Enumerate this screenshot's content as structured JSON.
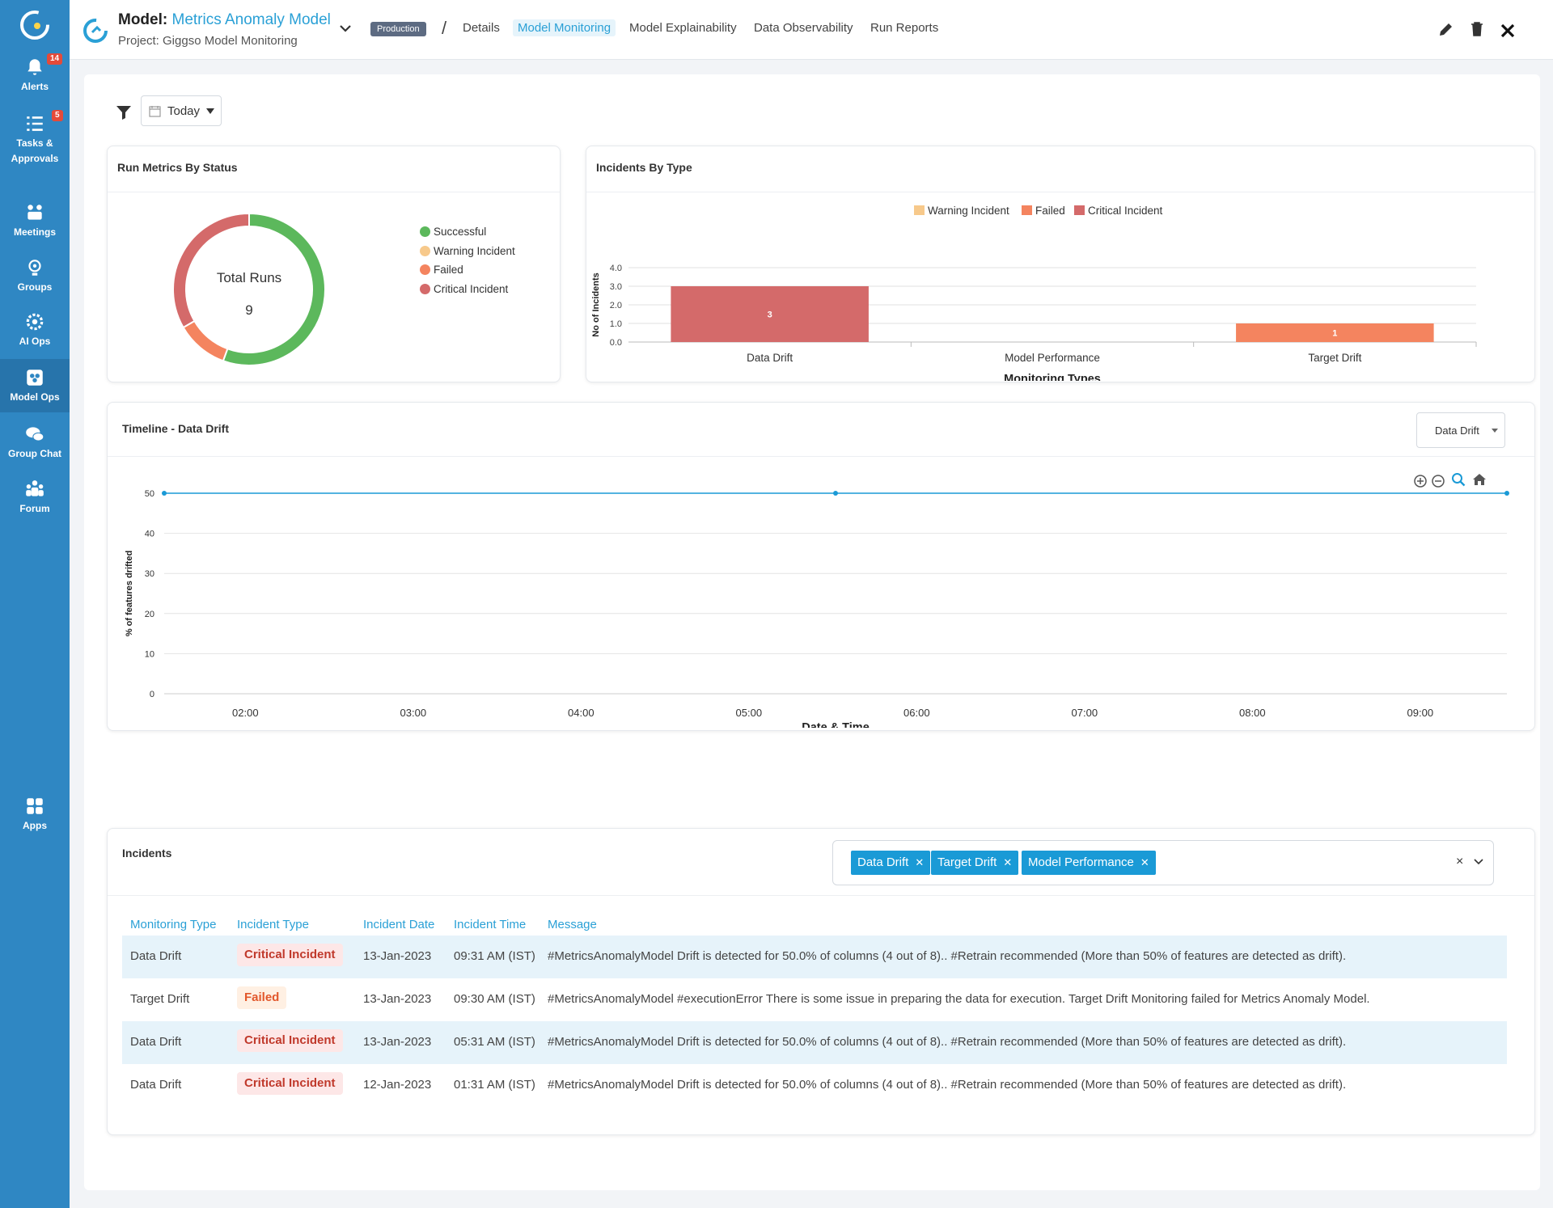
{
  "sidebar": {
    "items": [
      {
        "label": "Alerts",
        "badge": "14",
        "icon": "bell-icon"
      },
      {
        "label": "Tasks & Approvals",
        "badge": "5",
        "icon": "tasks-icon"
      },
      {
        "label": "Meetings",
        "icon": "meetings-icon"
      },
      {
        "label": "Groups",
        "icon": "groups-icon"
      },
      {
        "label": "AI Ops",
        "icon": "ai-ops-icon"
      },
      {
        "label": "Model Ops",
        "icon": "model-ops-icon",
        "active": true
      },
      {
        "label": "Group Chat",
        "icon": "chat-icon"
      },
      {
        "label": "Forum",
        "icon": "forum-icon"
      },
      {
        "label": "Apps",
        "icon": "apps-icon"
      }
    ]
  },
  "header": {
    "model_prefix": "Model:",
    "model_name": "Metrics Anomaly Model",
    "project": "Project: Giggso Model Monitoring",
    "env_badge": "Production",
    "separator": "/",
    "tabs": [
      "Details",
      "Model Monitoring",
      "Model Explainability",
      "Data Observability",
      "Run Reports"
    ],
    "active_tab": "Model Monitoring"
  },
  "filter": {
    "date_range": "Today"
  },
  "run_metrics": {
    "title": "Run Metrics By Status",
    "center_label": "Total Runs",
    "center_value": "9",
    "legend": [
      {
        "label": "Successful",
        "color": "#5cb85c"
      },
      {
        "label": "Warning Incident",
        "color": "#f7c98b"
      },
      {
        "label": "Failed",
        "color": "#f4845f"
      },
      {
        "label": "Critical Incident",
        "color": "#d46a6a"
      }
    ]
  },
  "incidents_by_type": {
    "title": "Incidents By Type",
    "legend": [
      {
        "label": "Warning Incident",
        "color": "#f7c98b"
      },
      {
        "label": "Failed",
        "color": "#f4845f"
      },
      {
        "label": "Critical Incident",
        "color": "#d46a6a"
      }
    ]
  },
  "timeline": {
    "title": "Timeline - Data Drift",
    "selector": "Data Drift"
  },
  "incidents": {
    "title": "Incidents",
    "tags": [
      "Data Drift",
      "Target Drift",
      "Model Performance"
    ],
    "clear": "×",
    "columns": [
      "Monitoring Type",
      "Incident Type",
      "Incident Date",
      "Incident Time",
      "Message"
    ],
    "rows": [
      {
        "monitoring_type": "Data Drift",
        "incident_type": "Critical Incident",
        "date": "13-Jan-2023",
        "time": "09:31 AM (IST)",
        "message": "#MetricsAnomalyModel Drift is detected for 50.0% of columns (4 out of 8).. #Retrain recommended (More than 50% of features are detected as drift)."
      },
      {
        "monitoring_type": "Target Drift",
        "incident_type": "Failed",
        "date": "13-Jan-2023",
        "time": "09:30 AM (IST)",
        "message": "#MetricsAnomalyModel #executionError There is some issue in preparing the data for execution. Target Drift Monitoring failed for Metrics Anomaly Model."
      },
      {
        "monitoring_type": "Data Drift",
        "incident_type": "Critical Incident",
        "date": "13-Jan-2023",
        "time": "05:31 AM (IST)",
        "message": "#MetricsAnomalyModel Drift is detected for 50.0% of columns (4 out of 8).. #Retrain recommended (More than 50% of features are detected as drift)."
      },
      {
        "monitoring_type": "Data Drift",
        "incident_type": "Critical Incident",
        "date": "12-Jan-2023",
        "time": "01:31 AM (IST)",
        "message": "#MetricsAnomalyModel Drift is detected for 50.0% of columns (4 out of 8).. #Retrain recommended (More than 50% of features are detected as drift)."
      }
    ]
  },
  "chart_data": [
    {
      "type": "pie",
      "title": "Run Metrics By Status",
      "categories": [
        "Successful",
        "Warning Incident",
        "Failed",
        "Critical Incident"
      ],
      "values": [
        5,
        0,
        1,
        3
      ],
      "colors": [
        "#5cb85c",
        "#f7c98b",
        "#f4845f",
        "#d46a6a"
      ],
      "total": 9
    },
    {
      "type": "bar",
      "title": "Incidents By Type",
      "categories": [
        "Data Drift",
        "Model Performance",
        "Target Drift"
      ],
      "series": [
        {
          "name": "Warning Incident",
          "values": [
            0,
            0,
            0
          ],
          "color": "#f7c98b"
        },
        {
          "name": "Failed",
          "values": [
            0,
            0,
            1
          ],
          "color": "#f4845f"
        },
        {
          "name": "Critical Incident",
          "values": [
            3,
            0,
            0
          ],
          "color": "#d46a6a"
        }
      ],
      "xlabel": "Monitoring Types",
      "ylabel": "No of Incidents",
      "ylim": [
        0,
        4
      ],
      "yticks": [
        "0.0",
        "1.0",
        "2.0",
        "3.0",
        "4.0"
      ],
      "legend": "top"
    },
    {
      "type": "line",
      "title": "Timeline - Data Drift",
      "x": [
        "01:31",
        "05:31",
        "09:31"
      ],
      "y": [
        50,
        50,
        50
      ],
      "xticks": [
        "02:00",
        "03:00",
        "04:00",
        "05:00",
        "06:00",
        "07:00",
        "08:00",
        "09:00"
      ],
      "yticks": [
        "0",
        "10",
        "20",
        "30",
        "40",
        "50"
      ],
      "xlabel": "Date & Time",
      "ylabel": "% of features drifted",
      "ylim": [
        0,
        50
      ],
      "color": "#1a9ad6",
      "grid": true
    }
  ]
}
